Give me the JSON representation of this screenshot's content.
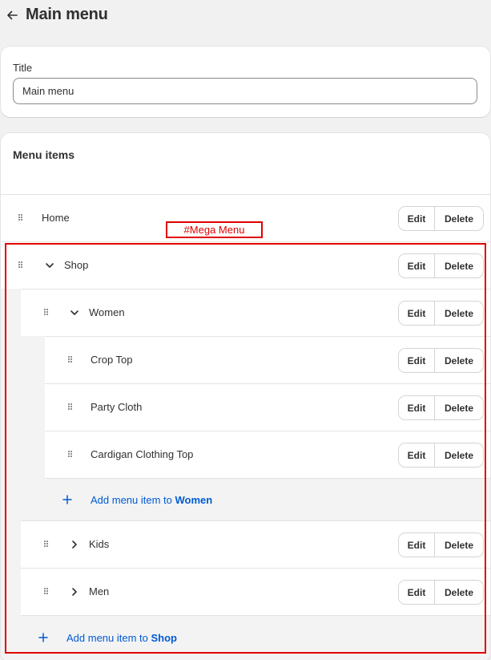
{
  "header": {
    "title": "Main menu",
    "back_icon": "arrow-left-icon"
  },
  "title_card": {
    "label": "Title",
    "value": "Main menu"
  },
  "menu_card": {
    "title": "Menu items"
  },
  "buttons": {
    "edit": "Edit",
    "delete": "Delete"
  },
  "items": {
    "home": {
      "label": "Home"
    },
    "shop": {
      "label": "Shop",
      "expanded": true
    },
    "women": {
      "label": "Women",
      "expanded": true
    },
    "crop_top": {
      "label": "Crop Top"
    },
    "party_cloth": {
      "label": "Party Cloth"
    },
    "cardigan": {
      "label": "Cardigan Clothing Top"
    },
    "kids": {
      "label": "Kids",
      "expanded": false
    },
    "men": {
      "label": "Men",
      "expanded": false
    }
  },
  "add_women": {
    "prefix": "Add menu item to ",
    "target": "Women"
  },
  "add_shop": {
    "prefix": "Add menu item to ",
    "target": "Shop"
  },
  "annotation": {
    "text": "#Mega Menu",
    "color": "#e00000"
  },
  "colors": {
    "accent": "#005bd3",
    "annotation": "#e00000",
    "text": "#303030",
    "background": "#f1f1f1"
  }
}
